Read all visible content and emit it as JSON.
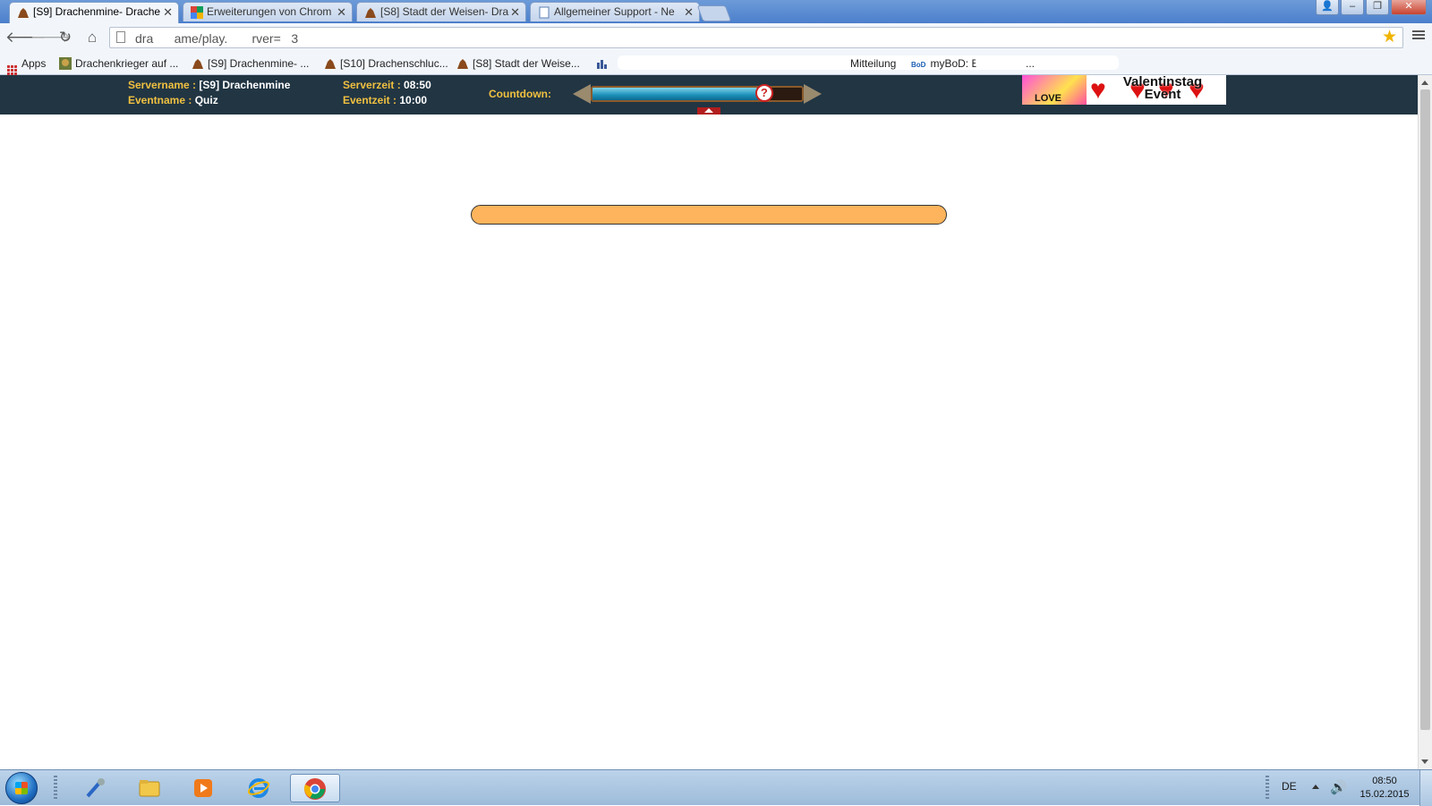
{
  "browser": {
    "tabs": [
      {
        "title": "[S9] Drachenmine- Drache",
        "active": true,
        "icon": "dragon-icon"
      },
      {
        "title": "Erweiterungen von Chrom",
        "active": false,
        "icon": "chrome-store-icon"
      },
      {
        "title": "[S8] Stadt der Weisen- Dra",
        "active": false,
        "icon": "dragon-icon"
      },
      {
        "title": "Allgemeiner Support - Ne",
        "active": false,
        "icon": "page-icon"
      }
    ],
    "address": "dra      ame/play.       rver=   3",
    "bookmarks": {
      "apps": "Apps",
      "items": [
        "Drachenkrieger auf ...",
        "[S9] Drachenmine- ...",
        "[S10] Drachenschluc...",
        "[S8] Stadt der Weise...",
        "Mitteilung",
        "myBoD: B"
      ],
      "bod_badge": "BoD",
      "more": "..."
    }
  },
  "game": {
    "servername_label": "Servername :",
    "servername_value": "[S9] Drachenmine",
    "eventname_label": "Eventname :",
    "eventname_value": "Quiz",
    "serverzeit_label": "Serverzeit :",
    "serverzeit_value": "08:50",
    "eventzeit_label": "Eventzeit :",
    "eventzeit_value": "10:00",
    "countdown_label": "Countdown:",
    "countdown_progress": 0.82,
    "countdown_knob": "?",
    "banner": {
      "love": "LOVE",
      "title_line1": "Valentinstag",
      "title_line2": "Event"
    }
  },
  "taskbar": {
    "language": "DE",
    "time": "08:50",
    "date": "15.02.2015"
  },
  "colors": {
    "header_bg": "#213543",
    "header_label": "#f0c040",
    "quiz_bar": "#fdb45c",
    "countdown_fill": "#1a8fb8"
  }
}
